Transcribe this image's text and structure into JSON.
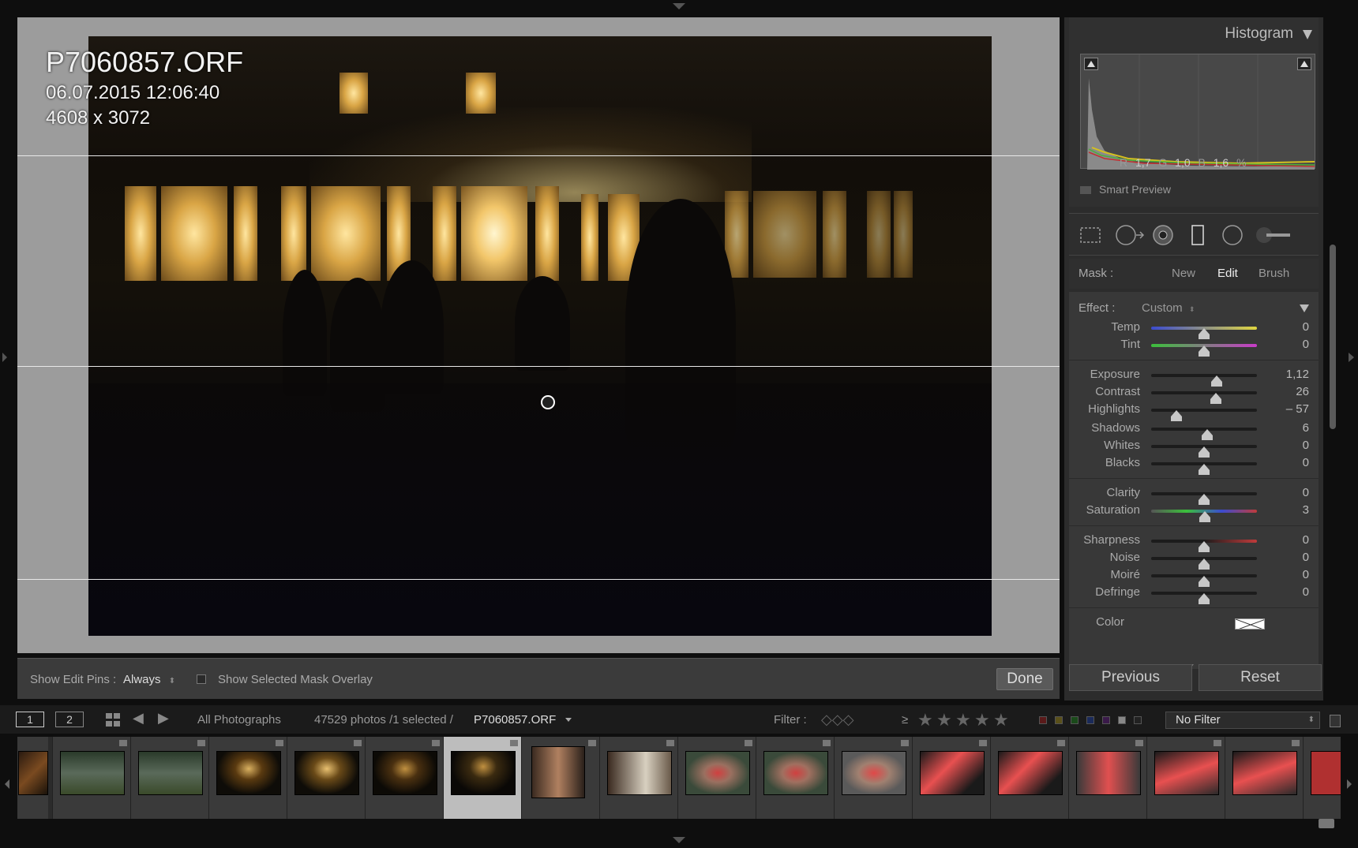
{
  "photo": {
    "filename": "P7060857.ORF",
    "datetime": "06.07.2015 12:06:40",
    "dimensions": "4608 x 3072"
  },
  "toolbar": {
    "edit_pins_label": "Show Edit Pins :",
    "edit_pins_value": "Always",
    "overlay_label": "Show Selected Mask Overlay",
    "done_label": "Done"
  },
  "histogram": {
    "title": "Histogram",
    "r_label": "R",
    "r_value": "1,7",
    "g_label": "G",
    "g_value": "1,0",
    "b_label": "B",
    "b_value": "1,6",
    "percent": "%",
    "smart_preview": "Smart Preview"
  },
  "mask": {
    "label": "Mask :",
    "new": "New",
    "edit": "Edit",
    "brush": "Brush"
  },
  "effect": {
    "label": "Effect :",
    "value": "Custom"
  },
  "adjustments": {
    "temp": {
      "label": "Temp",
      "value": "0",
      "pos": 0.5
    },
    "tint": {
      "label": "Tint",
      "value": "0",
      "pos": 0.5
    },
    "exposure": {
      "label": "Exposure",
      "value": "1,12",
      "pos": 0.62
    },
    "contrast": {
      "label": "Contrast",
      "value": "26",
      "pos": 0.61
    },
    "highlights": {
      "label": "Highlights",
      "value": "– 57",
      "pos": 0.24
    },
    "shadows": {
      "label": "Shadows",
      "value": "6",
      "pos": 0.53
    },
    "whites": {
      "label": "Whites",
      "value": "0",
      "pos": 0.5
    },
    "blacks": {
      "label": "Blacks",
      "value": "0",
      "pos": 0.5
    },
    "clarity": {
      "label": "Clarity",
      "value": "0",
      "pos": 0.5
    },
    "saturation": {
      "label": "Saturation",
      "value": "3",
      "pos": 0.51
    },
    "sharpness": {
      "label": "Sharpness",
      "value": "0",
      "pos": 0.5
    },
    "noise": {
      "label": "Noise",
      "value": "0",
      "pos": 0.5
    },
    "moire": {
      "label": "Moiré",
      "value": "0",
      "pos": 0.5
    },
    "defringe": {
      "label": "Defringe",
      "value": "0",
      "pos": 0.5
    },
    "color_label": "Color"
  },
  "buttons": {
    "previous": "Previous",
    "reset": "Reset"
  },
  "filmstrip_header": {
    "screen1": "1",
    "screen2": "2",
    "source": "All Photographs",
    "count": "47529 photos /1 selected /",
    "current": "P7060857.ORF",
    "filter_label": "Filter :",
    "rating_op": "≥",
    "filter_value": "No Filter"
  },
  "colors": {
    "accent_selected_cell": "#bdbdbd",
    "panel_bg": "#383838"
  }
}
